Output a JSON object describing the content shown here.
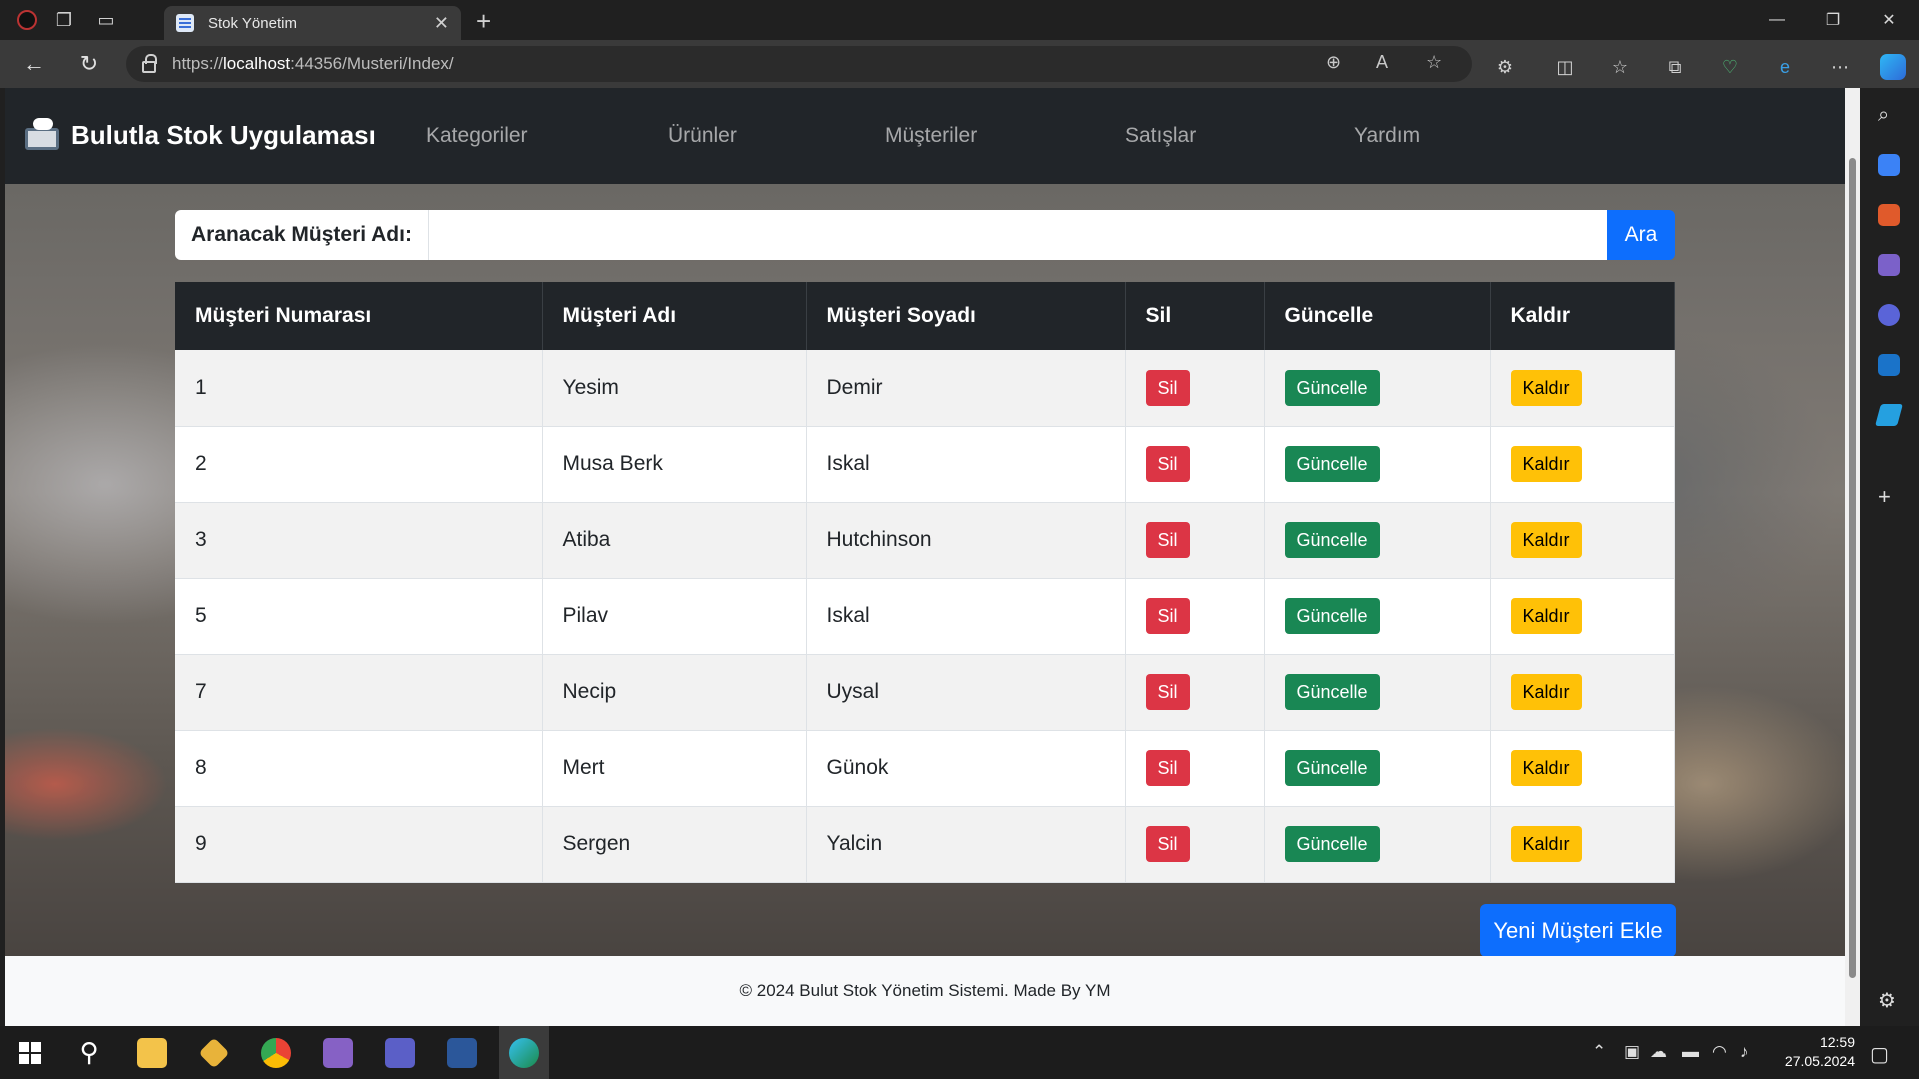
{
  "browser": {
    "tab_title": "Stok Yönetim",
    "url_prefix": "https://",
    "url_host": "localhost",
    "url_rest": ":44356/Musteri/Index/"
  },
  "navbar": {
    "brand": "Bulutla Stok Uygulaması",
    "items": [
      "Kategoriler",
      "Ürünler",
      "Müşteriler",
      "Satışlar",
      "Yardım"
    ]
  },
  "search": {
    "label": "Aranacak Müşteri Adı:",
    "value": "",
    "button": "Ara"
  },
  "table": {
    "headers": [
      "Müşteri Numarası",
      "Müşteri Adı",
      "Müşteri Soyadı",
      "Sil",
      "Güncelle",
      "Kaldır"
    ],
    "rows": [
      {
        "id": "1",
        "name": "Yesim",
        "surname": "Demir"
      },
      {
        "id": "2",
        "name": "Musa Berk",
        "surname": "Iskal"
      },
      {
        "id": "3",
        "name": "Atiba",
        "surname": "Hutchinson"
      },
      {
        "id": "5",
        "name": "Pilav",
        "surname": "Iskal"
      },
      {
        "id": "7",
        "name": "Necip",
        "surname": "Uysal"
      },
      {
        "id": "8",
        "name": "Mert",
        "surname": "Günok"
      },
      {
        "id": "9",
        "name": "Sergen",
        "surname": "Yalcin"
      }
    ],
    "delete_label": "Sil",
    "update_label": "Güncelle",
    "remove_label": "Kaldır"
  },
  "add_button": "Yeni Müşteri Ekle",
  "footer": "© 2024 Bulut Stok Yönetim Sistemi. Made By YM",
  "taskbar": {
    "time": "12:59",
    "date": "27.05.2024"
  },
  "colors": {
    "primary": "#0d6efd",
    "danger": "#dc3545",
    "success": "#198754",
    "warning": "#ffc107",
    "dark": "#212529"
  }
}
